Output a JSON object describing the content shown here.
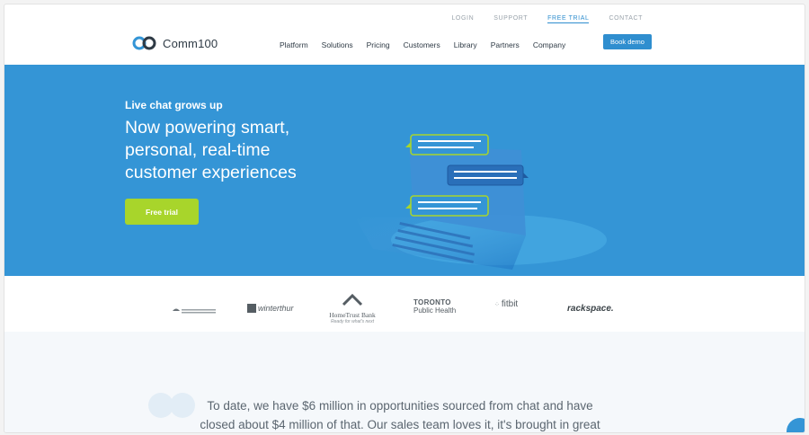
{
  "util_nav": [
    "LOGIN",
    "SUPPORT",
    "FREE TRIAL",
    "CONTACT"
  ],
  "brand": {
    "name": "Comm100"
  },
  "nav": [
    "Platform",
    "Solutions",
    "Pricing",
    "Customers",
    "Library",
    "Partners",
    "Company"
  ],
  "book_demo": "Book demo",
  "hero": {
    "eyebrow": "Live chat grows up",
    "headline": [
      "Now powering smart,",
      "personal, real-time",
      "customer experiences"
    ],
    "cta": "Free trial"
  },
  "logos": {
    "winterthur": "winterthur",
    "hometrust": "HomeTrust Bank",
    "hometrust_tag": "Ready for what's next",
    "toronto": "TORONTO",
    "toronto_sub": "Public Health",
    "fitbit": "fitbit",
    "rackspace": "rackspace."
  },
  "quote_lines": [
    "To date, we have $6 million in opportunities sourced from chat and have",
    "closed about $4 million of that. Our sales team loves it, it's brought in great"
  ],
  "colors": {
    "primary": "#3495d6",
    "accent": "#a8d52b",
    "dark": "#2e3a45"
  }
}
